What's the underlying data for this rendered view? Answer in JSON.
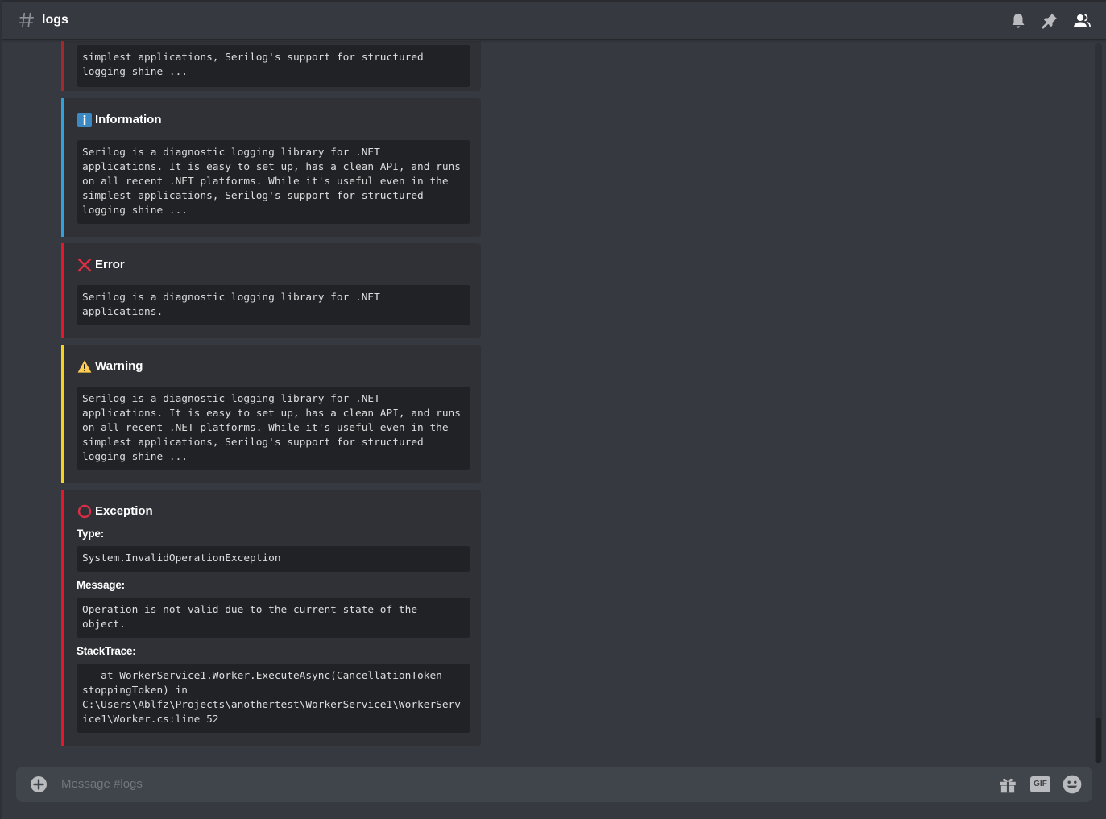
{
  "header": {
    "channel_name": "logs",
    "icons": [
      "hash-icon",
      "bell-icon",
      "pin-icon",
      "members-icon"
    ]
  },
  "embeds": [
    {
      "kind": "partial",
      "accent": "#a6272c",
      "code": "simplest applications, Serilog's support for structured\nlogging shine ..."
    },
    {
      "kind": "information",
      "accent": "#2fa2dd",
      "title": "Information",
      "icon": "info-icon",
      "code": "Serilog is a diagnostic logging library for .NET\napplications. It is easy to set up, has a clean API, and runs\non all recent .NET platforms. While it's useful even in the\nsimplest applications, Serilog's support for structured\nlogging shine ..."
    },
    {
      "kind": "error",
      "accent": "#e8162b",
      "title": "Error",
      "icon": "cross-icon",
      "code": "Serilog is a diagnostic logging library for .NET\napplications."
    },
    {
      "kind": "warning",
      "accent": "#f5d21b",
      "title": "Warning",
      "icon": "warning-icon",
      "code": "Serilog is a diagnostic logging library for .NET\napplications. It is easy to set up, has a clean API, and runs\non all recent .NET platforms. While it's useful even in the\nsimplest applications, Serilog's support for structured\nlogging shine ..."
    },
    {
      "kind": "exception",
      "accent": "#e8162b",
      "title": "Exception",
      "icon": "circle-icon",
      "fields": [
        {
          "name": "Type:",
          "code": "System.InvalidOperationException"
        },
        {
          "name": "Message:",
          "code": "Operation is not valid due to the current state of the\nobject."
        },
        {
          "name": "StackTrace:",
          "code": "   at WorkerService1.Worker.ExecuteAsync(CancellationToken\nstoppingToken) in\nC:\\Users\\Ablfz\\Projects\\anothertest\\WorkerService1\\WorkerServ\nice1\\Worker.cs:line 52"
        }
      ]
    }
  ],
  "composer": {
    "placeholder": "Message #logs",
    "gif_label": "GIF"
  },
  "colors": {
    "background": "#36393f",
    "embed_bg": "#2f3136",
    "code_bg": "#202225",
    "composer_bg": "#40444b"
  }
}
